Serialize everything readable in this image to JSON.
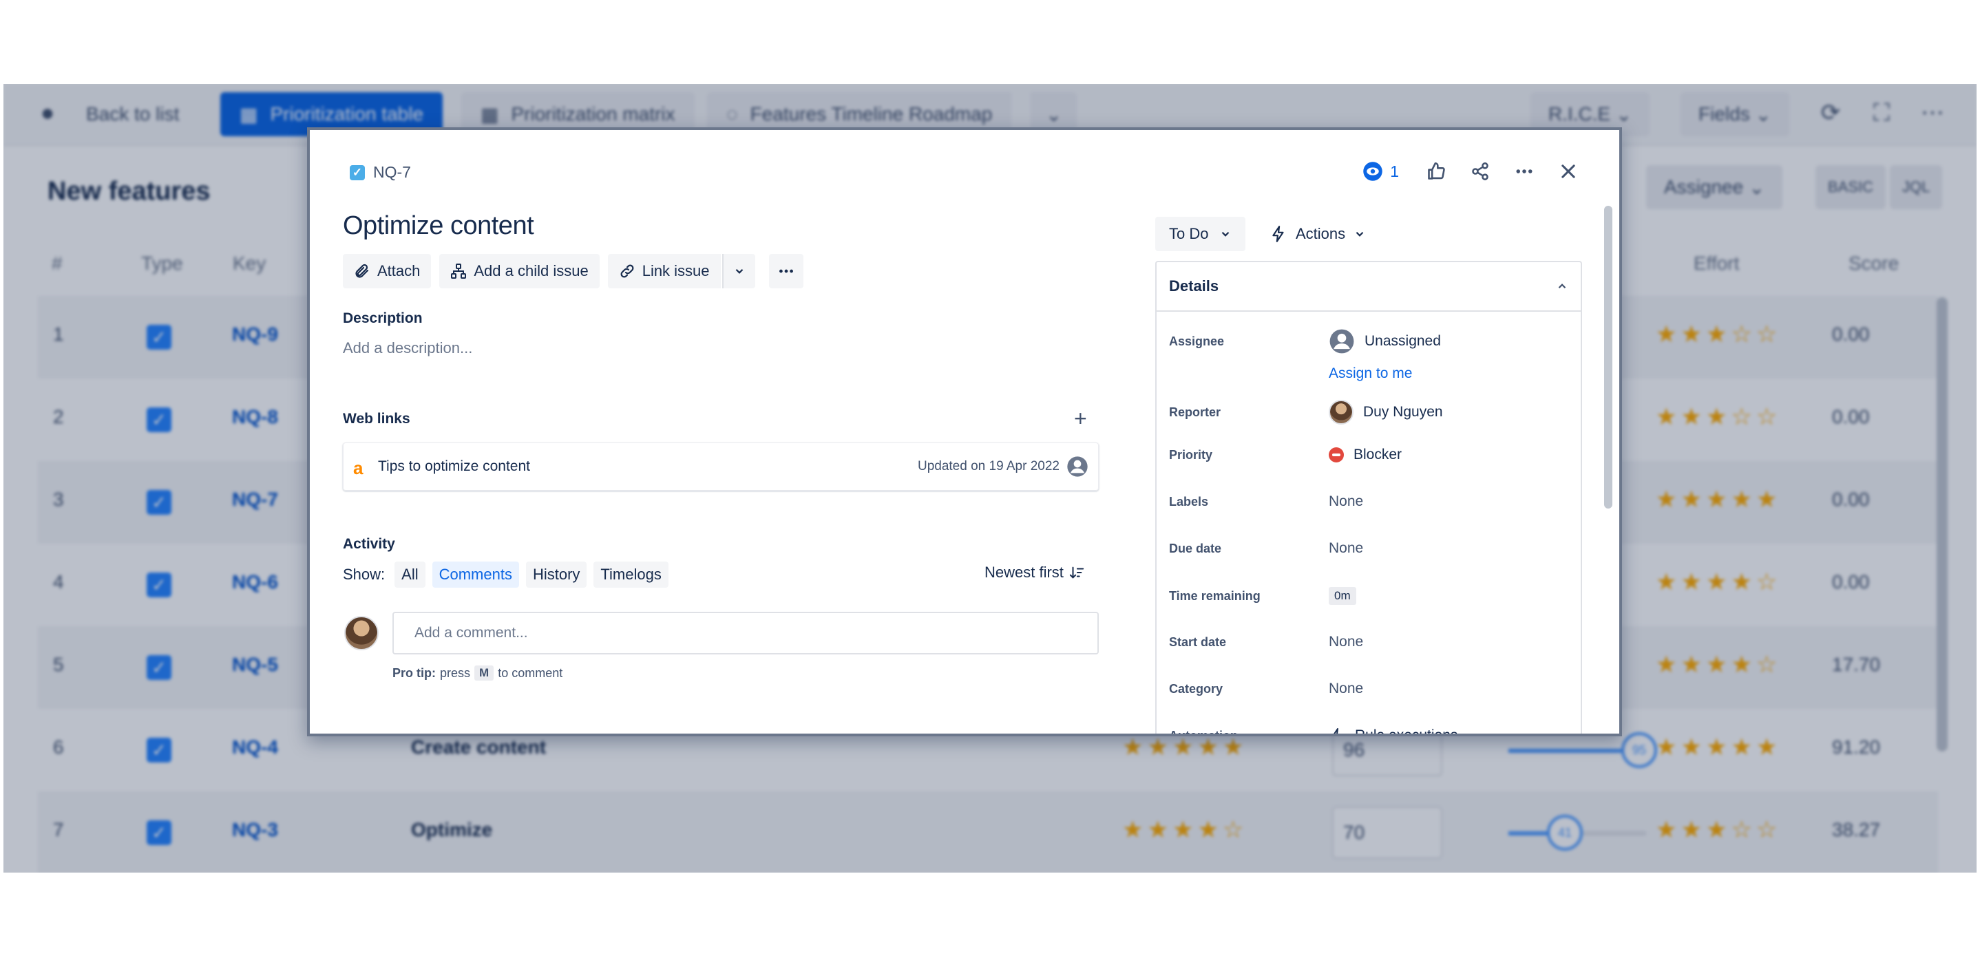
{
  "background": {
    "back_label": "Back to list",
    "tabs": [
      "Prioritization table",
      "Prioritization matrix",
      "Features Timeline Roadmap"
    ],
    "framework": "R.I.C.E",
    "fields_label": "Fields",
    "page_title": "New features",
    "assignee_filter": "Assignee",
    "mode_basic": "BASIC",
    "mode_jql": "JQL",
    "columns": {
      "num": "#",
      "type": "Type",
      "key": "Key",
      "effort": "Effort",
      "score": "Score"
    },
    "rows": [
      {
        "num": "1",
        "key": "NQ-9",
        "summary": "",
        "effort_stars": "★★★☆☆",
        "score": "0.00"
      },
      {
        "num": "2",
        "key": "NQ-8",
        "summary": "",
        "effort_stars": "★★★☆☆",
        "score": "0.00"
      },
      {
        "num": "3",
        "key": "NQ-7",
        "summary": "",
        "effort_stars": "★★★★★",
        "score": "0.00"
      },
      {
        "num": "4",
        "key": "NQ-6",
        "summary": "",
        "effort_stars": "★★★★☆",
        "score": "0.00"
      },
      {
        "num": "5",
        "key": "NQ-5",
        "summary": "",
        "effort_stars": "★★★★☆",
        "score": "17.70"
      },
      {
        "num": "6",
        "key": "NQ-4",
        "summary": "Create content",
        "impact_stars": "★★★★★",
        "confidence": "96",
        "reach": 95,
        "effort_stars": "★★★★★",
        "score": "91.20"
      },
      {
        "num": "7",
        "key": "NQ-3",
        "summary": "Optimize",
        "impact_stars": "★★★★☆",
        "confidence": "70",
        "reach": 41,
        "effort_stars": "★★★☆☆",
        "score": "38.27"
      }
    ]
  },
  "issue": {
    "key": "NQ-7",
    "title": "Optimize content",
    "watchers": "1",
    "toolbar": {
      "attach": "Attach",
      "child": "Add a child issue",
      "link": "Link issue"
    },
    "description_label": "Description",
    "description_placeholder": "Add a description...",
    "web_links_label": "Web links",
    "web_link": {
      "title": "Tips to optimize content",
      "updated": "Updated on 19 Apr 2022"
    },
    "activity_label": "Activity",
    "show_label": "Show:",
    "filters": [
      "All",
      "Comments",
      "History",
      "Timelogs"
    ],
    "selected_filter": "Comments",
    "sort_label": "Newest first",
    "comment_placeholder": "Add a comment...",
    "protip": {
      "prefix": "Pro tip:",
      "press": "press",
      "key": "M",
      "suffix": "to comment"
    }
  },
  "sidebar": {
    "status": "To Do",
    "actions": "Actions",
    "details_label": "Details",
    "fields": {
      "assignee_label": "Assignee",
      "assignee_value": "Unassigned",
      "assign_to_me": "Assign to me",
      "reporter_label": "Reporter",
      "reporter_value": "Duy Nguyen",
      "priority_label": "Priority",
      "priority_value": "Blocker",
      "labels_label": "Labels",
      "labels_value": "None",
      "due_label": "Due date",
      "due_value": "None",
      "time_label": "Time remaining",
      "time_value": "0m",
      "start_label": "Start date",
      "start_value": "None",
      "category_label": "Category",
      "category_value": "None",
      "automation_label": "Automation",
      "automation_value": "Rule executions"
    }
  },
  "colors": {
    "accent": "#0c66e4",
    "blocker": "#e2483d",
    "star": "#ffab00",
    "task": "#4bade8"
  }
}
